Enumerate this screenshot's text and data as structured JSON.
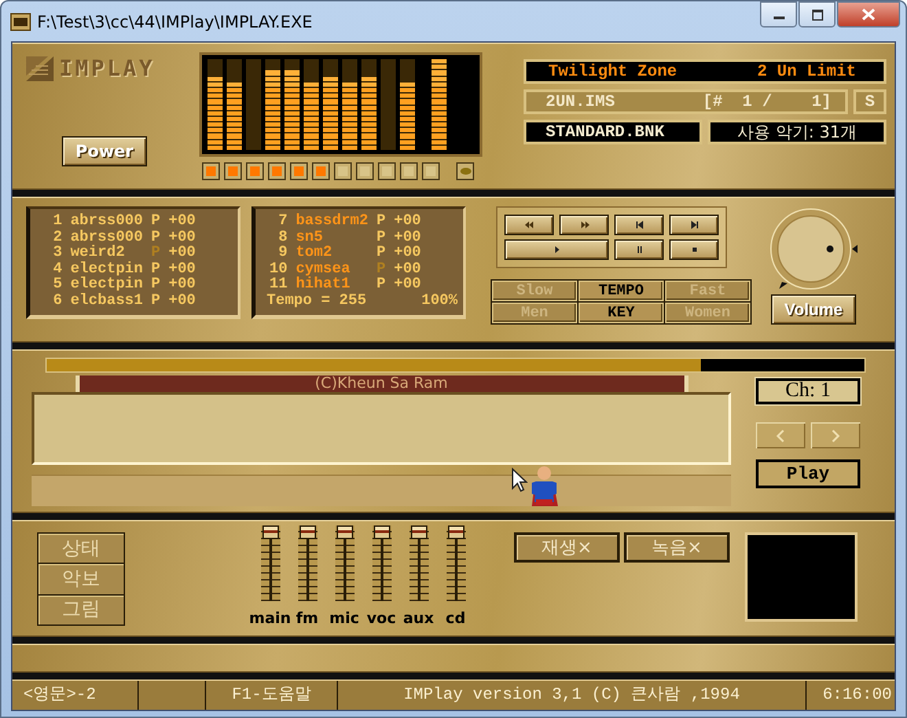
{
  "window": {
    "title": "F:\\Test\\3\\cc\\44\\IMPlay\\IMPLAY.EXE"
  },
  "logo": "IMPLAY",
  "power_button": "Power",
  "spectrum": {
    "bars": [
      {
        "level": 0.8
      },
      {
        "level": 0.75
      },
      {
        "level": 0.0
      },
      {
        "level": 0.88
      },
      {
        "level": 0.88
      },
      {
        "level": 0.75
      },
      {
        "level": 0.82
      },
      {
        "level": 0.75
      },
      {
        "level": 0.82
      },
      {
        "level": 0.0
      },
      {
        "level": 0.75
      }
    ],
    "master": {
      "level": 1.0
    }
  },
  "leds": [
    {
      "on": true
    },
    {
      "on": true
    },
    {
      "on": true
    },
    {
      "on": true
    },
    {
      "on": true
    },
    {
      "on": true
    },
    {
      "on": false
    },
    {
      "on": false
    },
    {
      "on": false
    },
    {
      "on": false
    },
    {
      "on": false
    }
  ],
  "song": {
    "title": "Twilight Zone",
    "artist": "2 Un Limit"
  },
  "file": {
    "name": "2UN.IMS",
    "index": "[#  1 /    1]",
    "mode": "S"
  },
  "bank": {
    "name": "STANDARD.BNK",
    "instruments": "사용 악기: 31개"
  },
  "channels": [
    {
      "number": "1",
      "name": "abrss000",
      "flag": "P",
      "flag_lit": true,
      "value": "+00",
      "kind": "melody"
    },
    {
      "number": "2",
      "name": "abrss000",
      "flag": "P",
      "flag_lit": true,
      "value": "+00",
      "kind": "melody"
    },
    {
      "number": "3",
      "name": "weird2",
      "flag": "P",
      "flag_lit": false,
      "value": "+00",
      "kind": "melody"
    },
    {
      "number": "4",
      "name": "electpin",
      "flag": "P",
      "flag_lit": true,
      "value": "+00",
      "kind": "melody"
    },
    {
      "number": "5",
      "name": "electpin",
      "flag": "P",
      "flag_lit": true,
      "value": "+00",
      "kind": "melody"
    },
    {
      "number": "6",
      "name": "elcbass1",
      "flag": "P",
      "flag_lit": true,
      "value": "+00",
      "kind": "melody"
    },
    {
      "number": "7",
      "name": "bassdrm2",
      "flag": "P",
      "flag_lit": true,
      "value": "+00",
      "kind": "rhythm"
    },
    {
      "number": "8",
      "name": "sn5",
      "flag": "P",
      "flag_lit": true,
      "value": "+00",
      "kind": "rhythm"
    },
    {
      "number": "9",
      "name": "tom2",
      "flag": "P",
      "flag_lit": true,
      "value": "+00",
      "kind": "rhythm"
    },
    {
      "number": "10",
      "name": "cymsea",
      "flag": "P",
      "flag_lit": false,
      "value": "+00",
      "kind": "rhythm"
    },
    {
      "number": "11",
      "name": "hihat1",
      "flag": "P",
      "flag_lit": true,
      "value": "+00",
      "kind": "rhythm"
    }
  ],
  "tempo": {
    "label": "Tempo = 255",
    "percent": "100%"
  },
  "transport": [
    {
      "kind": "rewind"
    },
    {
      "kind": "forward"
    },
    {
      "kind": "previous"
    },
    {
      "kind": "next"
    },
    {
      "kind": "play"
    },
    {
      "kind": "pause"
    },
    {
      "kind": "stop"
    }
  ],
  "modes": [
    {
      "label": "Slow",
      "active": false
    },
    {
      "label": "TEMPO",
      "active": true
    },
    {
      "label": "Fast",
      "active": false
    },
    {
      "label": "Men",
      "active": false
    },
    {
      "label": "KEY",
      "active": true
    },
    {
      "label": "Women",
      "active": false
    }
  ],
  "volume_button": "Volume",
  "progress": {
    "level": 0.8
  },
  "copyright": "(C)Kheun Sa Ram",
  "channel_display": "Ch: 1",
  "play_button": "Play",
  "view_buttons": [
    "상태",
    "악보",
    "그림"
  ],
  "faders": [
    {
      "label": "main",
      "level": 1.0
    },
    {
      "label": "fm",
      "level": 1.0
    },
    {
      "label": "mic",
      "level": 1.0
    },
    {
      "label": "voc",
      "level": 1.0
    },
    {
      "label": "aux",
      "level": 1.0
    },
    {
      "label": "cd",
      "level": 1.0
    }
  ],
  "record_buttons": [
    "재생×",
    "녹음×"
  ],
  "status_bar": [
    "<영문>-2",
    "F1-도움말",
    "IMPlay version 3,1  (C) 큰사람 ,1994",
    "6:16:00"
  ]
}
